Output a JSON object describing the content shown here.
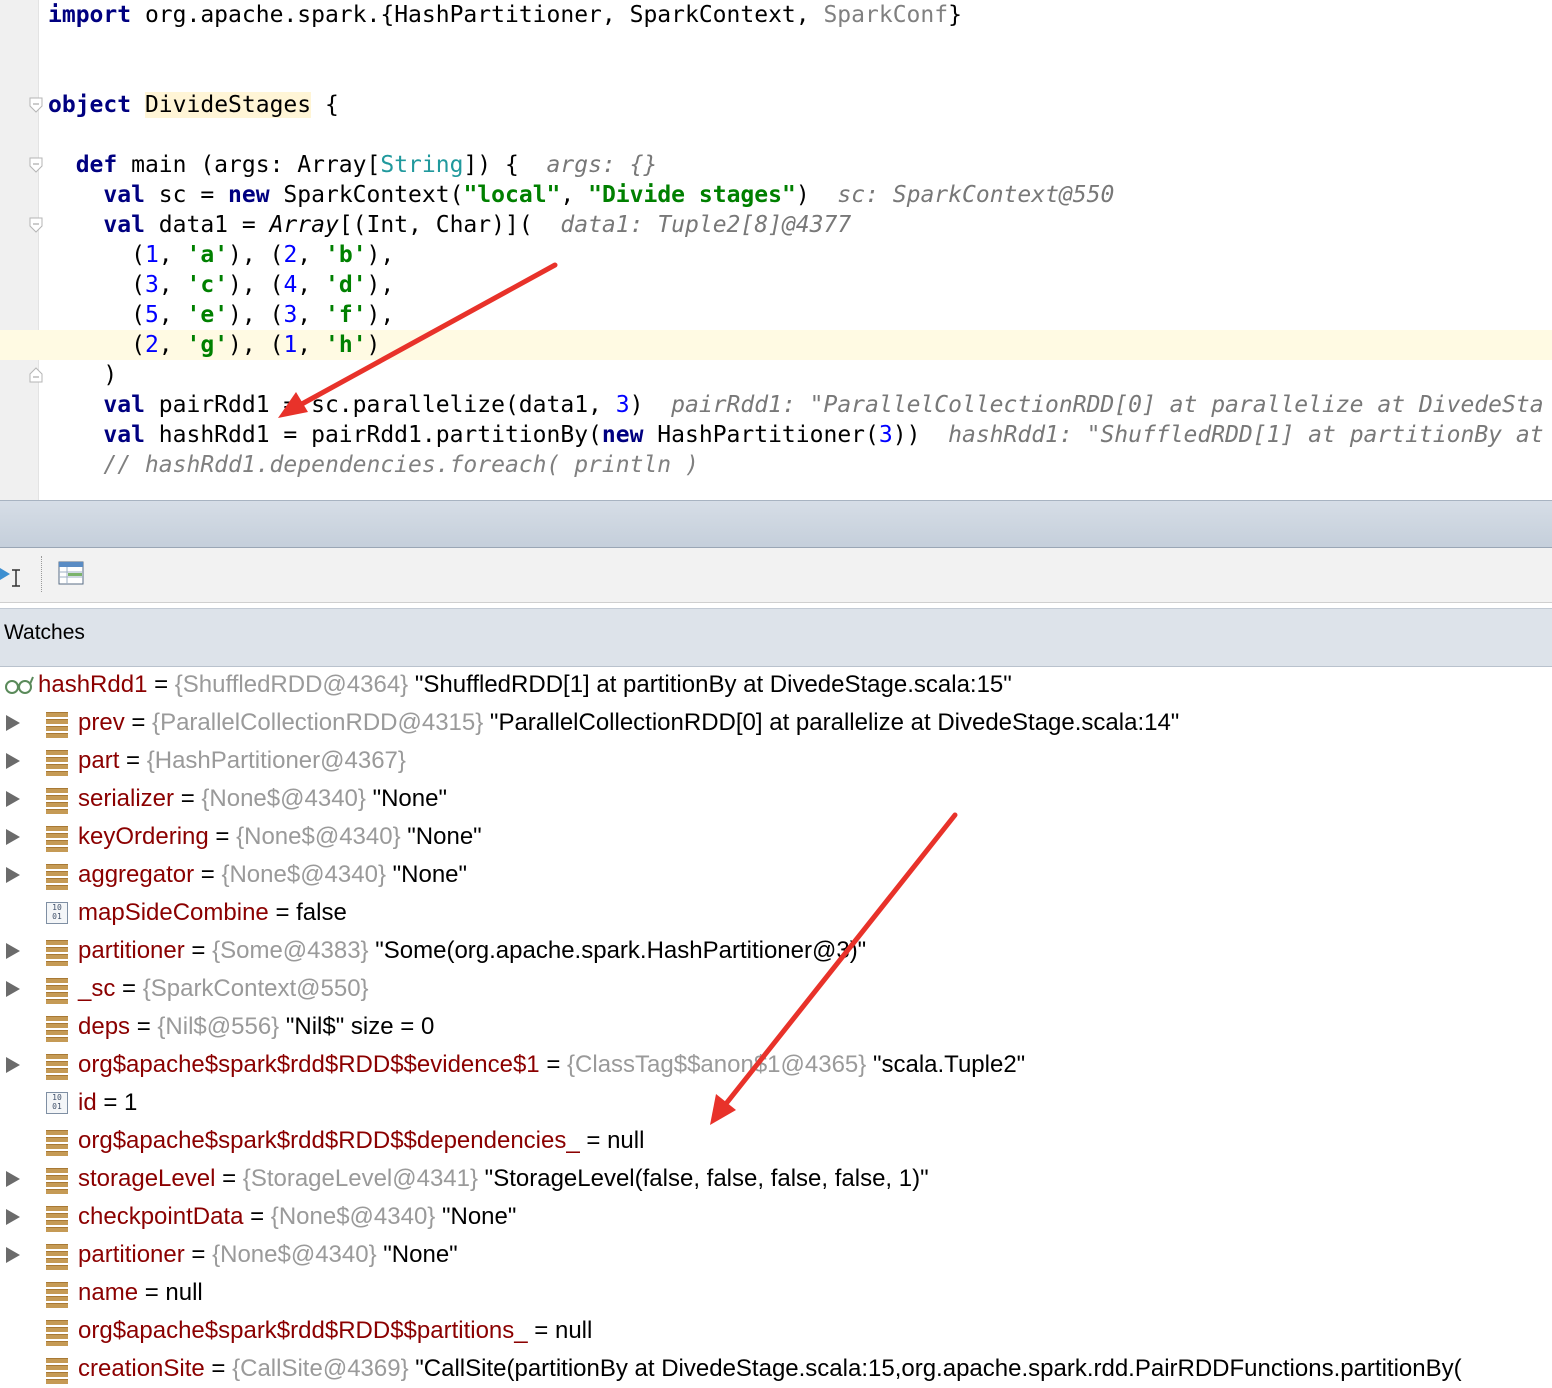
{
  "editor": {
    "import_line": {
      "kw": "import",
      "text": " org.apache.spark.{HashPartitioner, SparkContext, ",
      "unused": "SparkConf",
      "end": "}"
    },
    "object_line": {
      "kw": "object",
      "name": "DivideStages",
      "rest": " {"
    },
    "main_line": {
      "kw": "def",
      "pre": " main (args: Array[",
      "type": "String",
      "post": "]) {",
      "hint": "args: {}"
    },
    "sc_line": {
      "kw1": "val",
      "mid1": " sc = ",
      "kw2": "new",
      "mid2": " SparkContext(",
      "s1": "\"local\"",
      "comma": ", ",
      "s2": "\"Divide stages\"",
      "end": ")",
      "hint": "sc: SparkContext@550"
    },
    "data1_line": {
      "kw": "val",
      "pre": " data1 = ",
      "array": "Array",
      "post": "[(Int, Char)](",
      "hint": "data1: Tuple2[8]@4377"
    },
    "tuples": [
      [
        [
          "1",
          "'a'"
        ],
        [
          "2",
          "'b'"
        ]
      ],
      [
        [
          "3",
          "'c'"
        ],
        [
          "4",
          "'d'"
        ]
      ],
      [
        [
          "5",
          "'e'"
        ],
        [
          "3",
          "'f'"
        ]
      ],
      [
        [
          "2",
          "'g'"
        ],
        [
          "1",
          "'h'"
        ]
      ]
    ],
    "close_paren": ")",
    "pair_line": {
      "kw": "val",
      "pre": " pairRdd1 = sc.parallelize(data1, ",
      "num": "3",
      "end": ")",
      "hint": "pairRdd1: \"ParallelCollectionRDD[0] at parallelize at DivedeSta"
    },
    "hash_line": {
      "kw1": "val",
      "pre": " hashRdd1 = pairRdd1.partitionBy(",
      "kw2": "new",
      "mid": " HashPartitioner(",
      "num": "3",
      "end": "))",
      "hint": "hashRdd1: \"ShuffledRDD[1] at partitionBy at"
    },
    "comment_line": "// hashRdd1.dependencies.foreach( println )"
  },
  "panel": {
    "watches_title": "Watches",
    "root": {
      "name": "hashRdd1",
      "eq": " = ",
      "ref": "{ShuffledRDD@4364}",
      "value": " \"ShuffledRDD[1] at partitionBy at DivedeStage.scala:15\""
    },
    "rows": [
      {
        "expandable": true,
        "icon": "field",
        "name": "prev",
        "ref": "{ParallelCollectionRDD@4315}",
        "value": " \"ParallelCollectionRDD[0] at parallelize at DivedeStage.scala:14\""
      },
      {
        "expandable": true,
        "icon": "field",
        "name": "part",
        "ref": "{HashPartitioner@4367}",
        "value": ""
      },
      {
        "expandable": true,
        "icon": "field",
        "name": "serializer",
        "ref": "{None$@4340}",
        "value": " \"None\""
      },
      {
        "expandable": true,
        "icon": "field",
        "name": "keyOrdering",
        "ref": "{None$@4340}",
        "value": " \"None\""
      },
      {
        "expandable": true,
        "icon": "field",
        "name": "aggregator",
        "ref": "{None$@4340}",
        "value": " \"None\""
      },
      {
        "expandable": false,
        "icon": "primitive",
        "name": "mapSideCombine",
        "ref": "",
        "value": "false"
      },
      {
        "expandable": true,
        "icon": "field",
        "name": "partitioner",
        "ref": "{Some@4383}",
        "value": " \"Some(org.apache.spark.HashPartitioner@3)\""
      },
      {
        "expandable": true,
        "icon": "field",
        "name": "_sc",
        "ref": "{SparkContext@550}",
        "value": ""
      },
      {
        "expandable": false,
        "icon": "field",
        "name": "deps",
        "ref": "{Nil$@556}",
        "value": " \"Nil$\" size = 0"
      },
      {
        "expandable": true,
        "icon": "field",
        "name": "org$apache$spark$rdd$RDD$$evidence$1",
        "ref": "{ClassTag$$anon$1@4365}",
        "value": " \"scala.Tuple2\""
      },
      {
        "expandable": false,
        "icon": "primitive",
        "name": "id",
        "ref": "",
        "value": "1"
      },
      {
        "expandable": false,
        "icon": "field",
        "name": "org$apache$spark$rdd$RDD$$dependencies_",
        "ref": "",
        "value": "null"
      },
      {
        "expandable": true,
        "icon": "field",
        "name": "storageLevel",
        "ref": "{StorageLevel@4341}",
        "value": " \"StorageLevel(false, false, false, false, 1)\""
      },
      {
        "expandable": true,
        "icon": "field",
        "name": "checkpointData",
        "ref": "{None$@4340}",
        "value": " \"None\""
      },
      {
        "expandable": true,
        "icon": "field",
        "name": "partitioner",
        "ref": "{None$@4340}",
        "value": " \"None\""
      },
      {
        "expandable": false,
        "icon": "field",
        "name": "name",
        "ref": "",
        "value": "null"
      },
      {
        "expandable": false,
        "icon": "field",
        "name": "org$apache$spark$rdd$RDD$$partitions_",
        "ref": "",
        "value": "null"
      },
      {
        "expandable": false,
        "icon": "field",
        "name": "creationSite",
        "ref": "{CallSite@4369}",
        "value": " \"CallSite(partitionBy at DivedeStage.scala:15,org.apache.spark.rdd.PairRDDFunctions.partitionBy("
      }
    ],
    "eq": " = "
  },
  "annotations": {
    "arrow_color": "#e8322a"
  }
}
